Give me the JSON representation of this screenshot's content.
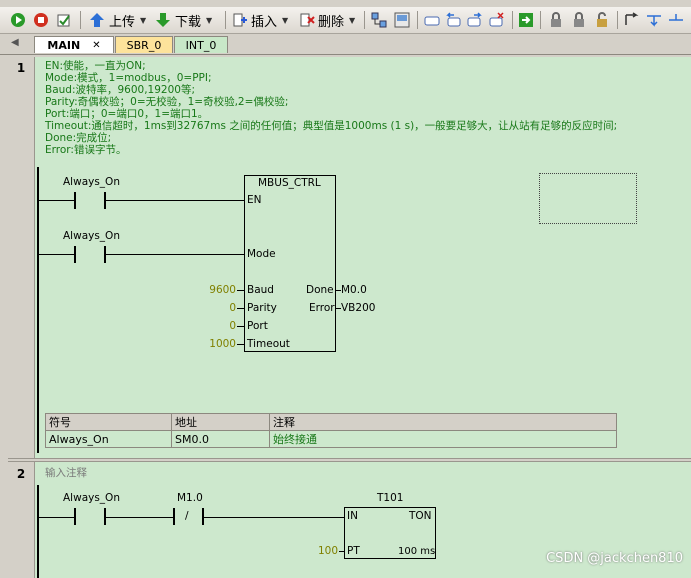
{
  "toolbar": {
    "upload_label": "上传",
    "download_label": "下载",
    "insert_label": "插入",
    "delete_label": "删除"
  },
  "tabs": [
    {
      "label": "MAIN",
      "close": "✕"
    },
    {
      "label": "SBR_0"
    },
    {
      "label": "INT_0"
    }
  ],
  "network1": {
    "number": "1",
    "comments": [
      "EN:使能，一直为ON;",
      "Mode:模式，1=modbus，0=PPI;",
      "Baud:波特率，9600,19200等;",
      "Parity:奇偶校验；0=无校验，1=奇校验,2=偶校验;",
      "Port:端口；0=端口0，1=端口1。",
      "Timeout:通信超时，1ms到32767ms 之间的任何值；典型值是1000ms (1 s)，一般要足够大，让从站有足够的反应时间;",
      "Done:完成位;",
      "Error:错误字节。"
    ],
    "contact1": "Always_On",
    "contact2": "Always_On",
    "block": {
      "name": "MBUS_CTRL",
      "pins_in": [
        "EN",
        "Mode",
        "Baud",
        "Parity",
        "Port",
        "Timeout"
      ],
      "pins_out": [
        "Done",
        "Error"
      ],
      "values_in": [
        "9600",
        "0",
        "0",
        "1000"
      ],
      "values_out": [
        "M0.0",
        "VB200"
      ]
    },
    "symbol_table": {
      "headers": [
        "符号",
        "地址",
        "注释"
      ],
      "rows": [
        [
          "Always_On",
          "SM0.0",
          "始终接通"
        ]
      ]
    }
  },
  "network2": {
    "number": "2",
    "comment": "输入注释",
    "contact1": "Always_On",
    "contact2": "M1.0",
    "contact2_type": "/",
    "timer": {
      "name": "T101",
      "in": "IN",
      "type": "TON",
      "pt": "PT",
      "pt_value": "100",
      "base": "100 ms"
    }
  },
  "watermark": "CSDN @jackchen810"
}
